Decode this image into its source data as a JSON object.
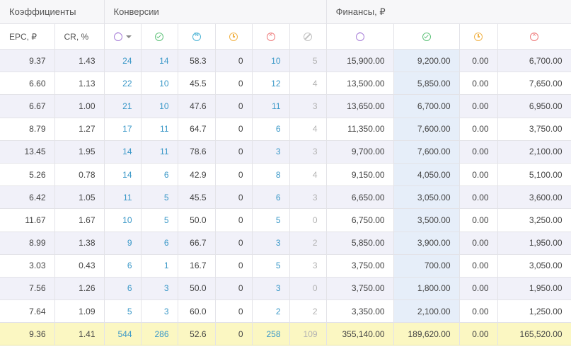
{
  "groups": {
    "coefficients": "Коэффициенты",
    "conversions": "Конверсии",
    "finance": "Финансы, ₽"
  },
  "columns": {
    "epc": "EPC, ₽",
    "cr": "CR, %"
  },
  "icons": {
    "conv_all": "all-conversions-icon",
    "conv_approved": "approved-icon",
    "conv_percent": "percent-icon",
    "conv_hold": "hold-clock-icon",
    "conv_rejected": "rejected-icon",
    "conv_trash": "trash-icon",
    "fin_all": "all-conversions-icon",
    "fin_approved": "approved-icon",
    "fin_hold": "hold-clock-icon",
    "fin_rejected": "rejected-icon"
  },
  "colors": {
    "link": "#3a98c8",
    "muted": "#b3b3b3",
    "highlight_column": "#e6eef9",
    "total_row": "#fbf7c2",
    "stripe": "#f1f1f9"
  },
  "rows": [
    [
      "9.37",
      "1.43",
      "24",
      "14",
      "58.3",
      "0",
      "10",
      "5",
      "15,900.00",
      "9,200.00",
      "0.00",
      "6,700.00"
    ],
    [
      "6.60",
      "1.13",
      "22",
      "10",
      "45.5",
      "0",
      "12",
      "4",
      "13,500.00",
      "5,850.00",
      "0.00",
      "7,650.00"
    ],
    [
      "6.67",
      "1.00",
      "21",
      "10",
      "47.6",
      "0",
      "11",
      "3",
      "13,650.00",
      "6,700.00",
      "0.00",
      "6,950.00"
    ],
    [
      "8.79",
      "1.27",
      "17",
      "11",
      "64.7",
      "0",
      "6",
      "4",
      "11,350.00",
      "7,600.00",
      "0.00",
      "3,750.00"
    ],
    [
      "13.45",
      "1.95",
      "14",
      "11",
      "78.6",
      "0",
      "3",
      "3",
      "9,700.00",
      "7,600.00",
      "0.00",
      "2,100.00"
    ],
    [
      "5.26",
      "0.78",
      "14",
      "6",
      "42.9",
      "0",
      "8",
      "4",
      "9,150.00",
      "4,050.00",
      "0.00",
      "5,100.00"
    ],
    [
      "6.42",
      "1.05",
      "11",
      "5",
      "45.5",
      "0",
      "6",
      "3",
      "6,650.00",
      "3,050.00",
      "0.00",
      "3,600.00"
    ],
    [
      "11.67",
      "1.67",
      "10",
      "5",
      "50.0",
      "0",
      "5",
      "0",
      "6,750.00",
      "3,500.00",
      "0.00",
      "3,250.00"
    ],
    [
      "8.99",
      "1.38",
      "9",
      "6",
      "66.7",
      "0",
      "3",
      "2",
      "5,850.00",
      "3,900.00",
      "0.00",
      "1,950.00"
    ],
    [
      "3.03",
      "0.43",
      "6",
      "1",
      "16.7",
      "0",
      "5",
      "3",
      "3,750.00",
      "700.00",
      "0.00",
      "3,050.00"
    ],
    [
      "7.56",
      "1.26",
      "6",
      "3",
      "50.0",
      "0",
      "3",
      "0",
      "3,750.00",
      "1,800.00",
      "0.00",
      "1,950.00"
    ],
    [
      "7.64",
      "1.09",
      "5",
      "3",
      "60.0",
      "0",
      "2",
      "2",
      "3,350.00",
      "2,100.00",
      "0.00",
      "1,250.00"
    ]
  ],
  "totals": [
    "9.36",
    "1.41",
    "544",
    "286",
    "52.6",
    "0",
    "258",
    "109",
    "355,140.00",
    "189,620.00",
    "0.00",
    "165,520.00"
  ]
}
